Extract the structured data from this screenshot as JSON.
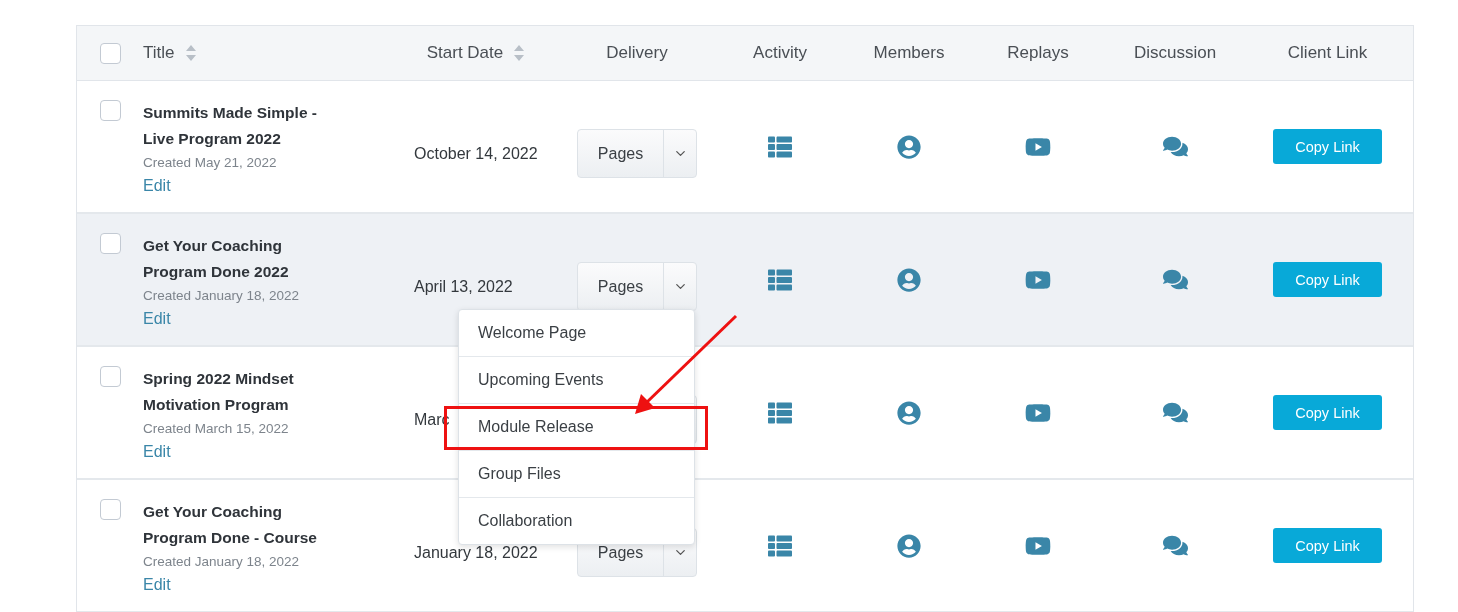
{
  "table": {
    "columns": [
      {
        "label": "Title",
        "sortable": true
      },
      {
        "label": "Start Date",
        "sortable": true
      },
      {
        "label": "Delivery",
        "sortable": false
      },
      {
        "label": "Activity",
        "sortable": false
      },
      {
        "label": "Members",
        "sortable": false
      },
      {
        "label": "Replays",
        "sortable": false
      },
      {
        "label": "Discussion",
        "sortable": false
      },
      {
        "label": "Client Link",
        "sortable": false
      }
    ],
    "select_all": {
      "checked": false
    },
    "rows": [
      {
        "checked": false,
        "hovered": false,
        "title": "Summits Made Simple - Live Program 2022",
        "created": "Created May 21, 2022",
        "edit": "Edit",
        "start_date": "October 14, 2022",
        "delivery": "Pages",
        "copy_link": "Copy Link"
      },
      {
        "checked": false,
        "hovered": true,
        "title": "Get Your Coaching Program Done 2022",
        "created": "Created January 18, 2022",
        "edit": "Edit",
        "start_date": "April 13, 2022",
        "delivery": "Pages",
        "copy_link": "Copy Link"
      },
      {
        "checked": false,
        "hovered": false,
        "title": "Spring 2022 Mindset Motivation Program",
        "created": "Created March 15, 2022",
        "edit": "Edit",
        "start_date": "Marc",
        "copy_link": "Copy Link"
      },
      {
        "checked": false,
        "hovered": false,
        "title": "Get Your Coaching Program Done - Course",
        "created": "Created January 18, 2022",
        "edit": "Edit",
        "start_date": "January 18, 2022",
        "delivery": "Pages",
        "copy_link": "Copy Link"
      }
    ]
  },
  "delivery_menu": {
    "items": [
      {
        "label": "Welcome Page",
        "highlighted": false
      },
      {
        "label": "Upcoming Events",
        "highlighted": false
      },
      {
        "label": "Module Release",
        "highlighted": true
      },
      {
        "label": "Group Files",
        "highlighted": false
      },
      {
        "label": "Collaboration",
        "highlighted": false
      }
    ]
  }
}
